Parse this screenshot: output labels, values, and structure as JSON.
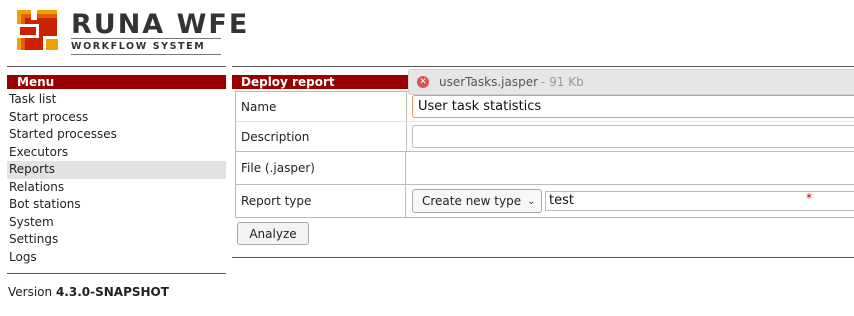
{
  "logo": {
    "title": "RUNA WFE",
    "subtitle": "WORKFLOW SYSTEM"
  },
  "sidebar": {
    "header": "Menu",
    "items": [
      {
        "label": "Task list"
      },
      {
        "label": "Start process"
      },
      {
        "label": "Started processes"
      },
      {
        "label": "Executors"
      },
      {
        "label": "Reports",
        "active": true
      },
      {
        "label": "Relations"
      },
      {
        "label": "Bot stations"
      },
      {
        "label": "System"
      },
      {
        "label": "Settings"
      },
      {
        "label": "Logs"
      }
    ],
    "version_prefix": "Version ",
    "version": "4.3.0-SNAPSHOT"
  },
  "main": {
    "header": "Deploy report",
    "name_label": "Name",
    "name_value": "User task statistics",
    "description_label": "Description",
    "description_value": "",
    "file_label": "File (.jasper)",
    "file_name": "userTasks.jasper",
    "file_size": "- 91 Kb",
    "type_label": "Report type",
    "type_select": "Create new type",
    "type_value": "test",
    "required_mark": "*",
    "analyze_button": "Analyze"
  },
  "colors": {
    "header_bg": "#9b0000",
    "active_item_bg": "#e2e2e2"
  },
  "icons": {
    "remove": "remove-circle-icon",
    "chevron": "chevron-down-icon"
  }
}
